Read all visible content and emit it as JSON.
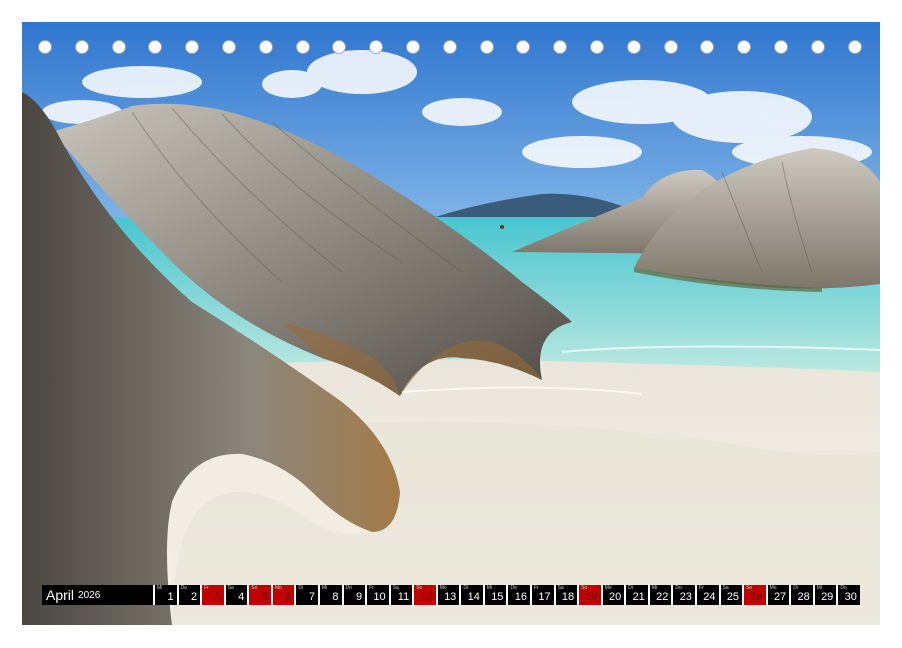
{
  "calendar": {
    "month": "April",
    "year": "2026",
    "days": [
      {
        "num": "1",
        "wd": "Mi",
        "red": false
      },
      {
        "num": "2",
        "wd": "Do",
        "red": false
      },
      {
        "num": "3",
        "wd": "Fr",
        "red": true
      },
      {
        "num": "4",
        "wd": "Sa",
        "red": false
      },
      {
        "num": "5",
        "wd": "So",
        "red": true
      },
      {
        "num": "6",
        "wd": "Mo",
        "red": true
      },
      {
        "num": "7",
        "wd": "Di",
        "red": false
      },
      {
        "num": "8",
        "wd": "Mi",
        "red": false
      },
      {
        "num": "9",
        "wd": "Do",
        "red": false
      },
      {
        "num": "10",
        "wd": "Fr",
        "red": false
      },
      {
        "num": "11",
        "wd": "Sa",
        "red": false
      },
      {
        "num": "12",
        "wd": "So",
        "red": true
      },
      {
        "num": "13",
        "wd": "Mo",
        "red": false
      },
      {
        "num": "14",
        "wd": "Di",
        "red": false
      },
      {
        "num": "15",
        "wd": "Mi",
        "red": false
      },
      {
        "num": "16",
        "wd": "Do",
        "red": false
      },
      {
        "num": "17",
        "wd": "Fr",
        "red": false
      },
      {
        "num": "18",
        "wd": "Sa",
        "red": false
      },
      {
        "num": "19",
        "wd": "So",
        "red": true
      },
      {
        "num": "20",
        "wd": "Mo",
        "red": false
      },
      {
        "num": "21",
        "wd": "Di",
        "red": false
      },
      {
        "num": "22",
        "wd": "Mi",
        "red": false
      },
      {
        "num": "23",
        "wd": "Do",
        "red": false
      },
      {
        "num": "24",
        "wd": "Fr",
        "red": false
      },
      {
        "num": "25",
        "wd": "Sa",
        "red": false
      },
      {
        "num": "26",
        "wd": "So",
        "red": true
      },
      {
        "num": "27",
        "wd": "Mo",
        "red": false
      },
      {
        "num": "28",
        "wd": "Di",
        "red": false
      },
      {
        "num": "29",
        "wd": "Mi",
        "red": false
      },
      {
        "num": "30",
        "wd": "Do",
        "red": false
      }
    ]
  },
  "colors": {
    "sky": "#3b7fd1",
    "water": "#7fd7d6",
    "sand": "#f1ece2",
    "rock": "#7d7a74",
    "calendar_bar": "#000000",
    "holiday": "#c10000"
  }
}
